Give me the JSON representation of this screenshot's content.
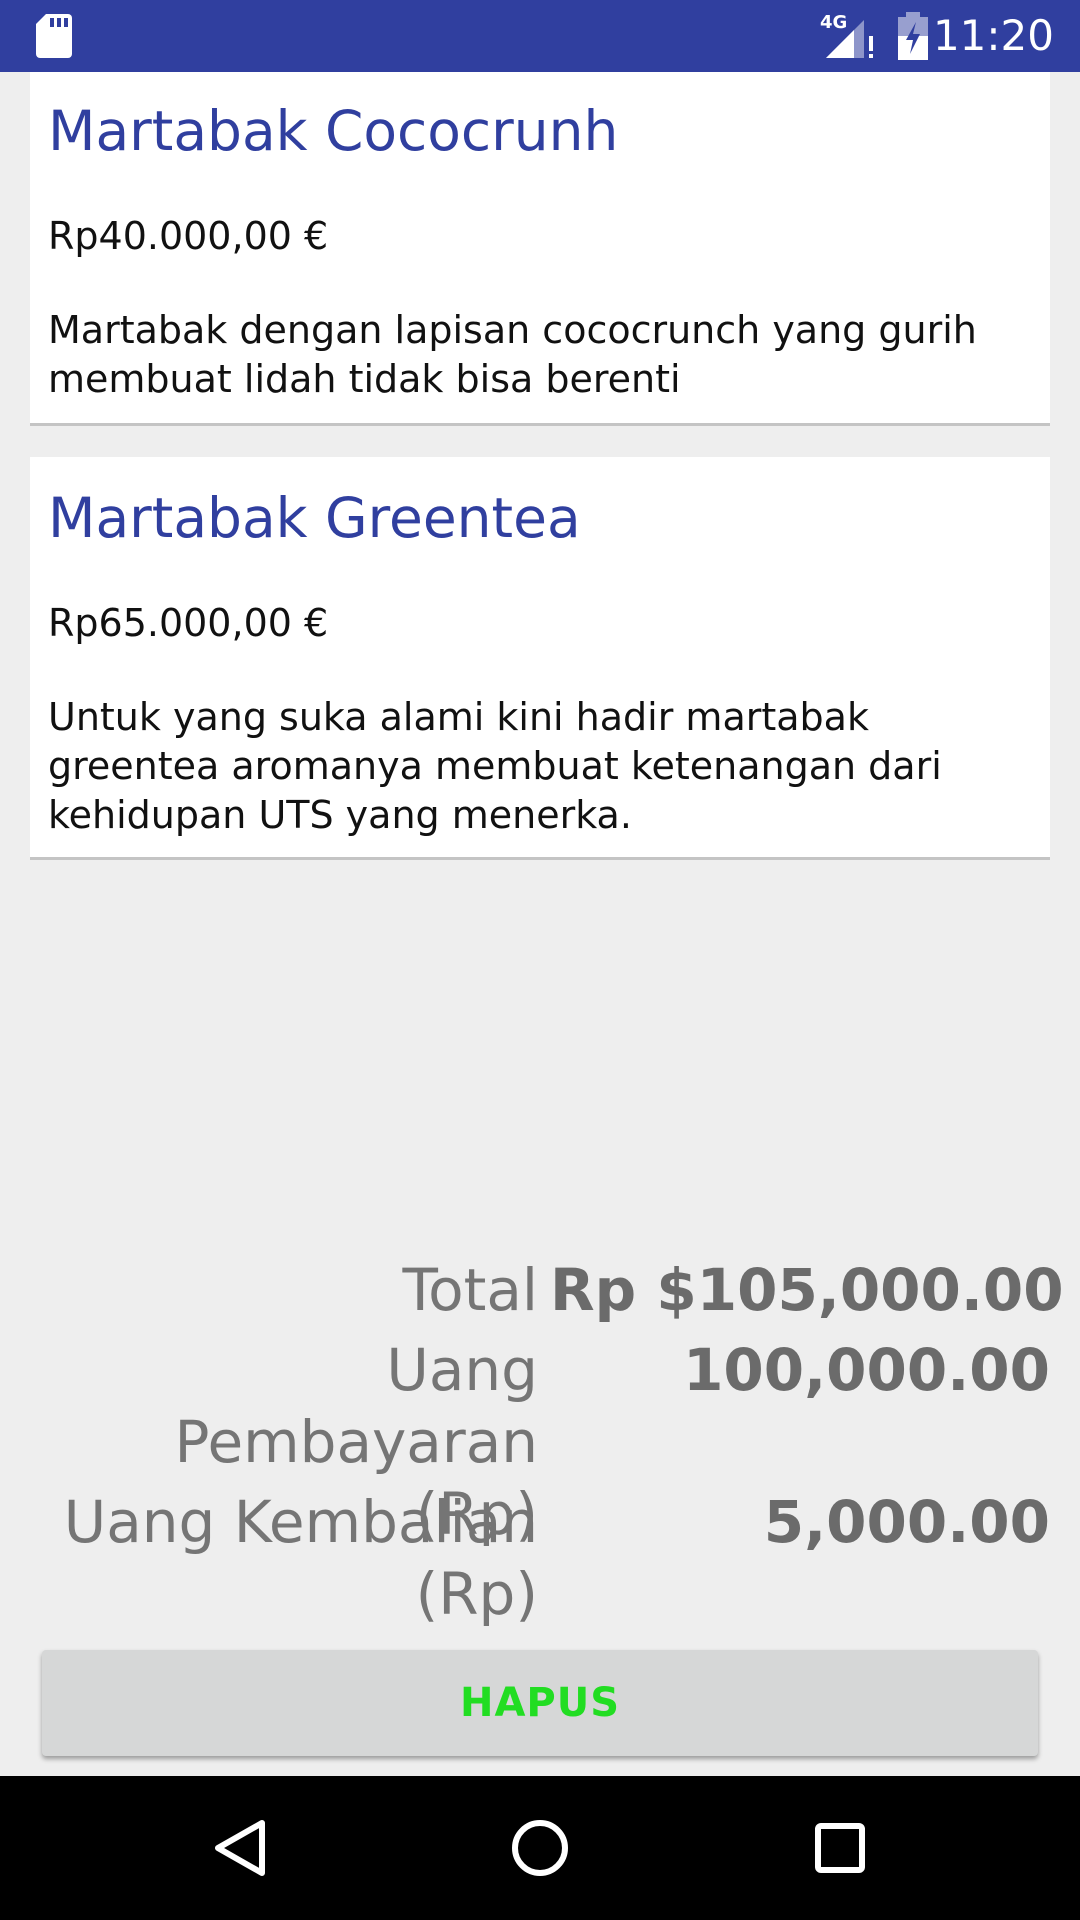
{
  "status_bar": {
    "time": "11:20",
    "network_type": "4G",
    "icons": [
      "sd-card-icon",
      "signal-icon",
      "battery-icon"
    ],
    "background_color": "#303f9f"
  },
  "menu_items": [
    {
      "title": "Martabak Cococrunh",
      "price": "Rp40.000,00 €",
      "description": "Martabak dengan lapisan cococrunch yang gurih membuat lidah tidak bisa berenti"
    },
    {
      "title": "Martabak Greentea",
      "price": "Rp65.000,00 €",
      "description": "Untuk yang suka alami kini hadir martabak greentea aromanya membuat ketenangan dari kehidupan UTS yang menerka."
    }
  ],
  "summary": {
    "total_label": "Total",
    "total_value": "Rp $105,000.00",
    "paid_label": "Uang Pembayaran (Rp)",
    "paid_value": "100,000.00",
    "change_label": "Uang Kembalian (Rp)",
    "change_value": "5,000.00"
  },
  "actions": {
    "clear_label": "HAPUS",
    "clear_color": "#22dd22"
  },
  "nav_bar": {
    "icons": [
      "back-icon",
      "home-icon",
      "recents-icon"
    ]
  },
  "colors": {
    "accent": "#303f9f",
    "background": "#eeeeee"
  }
}
